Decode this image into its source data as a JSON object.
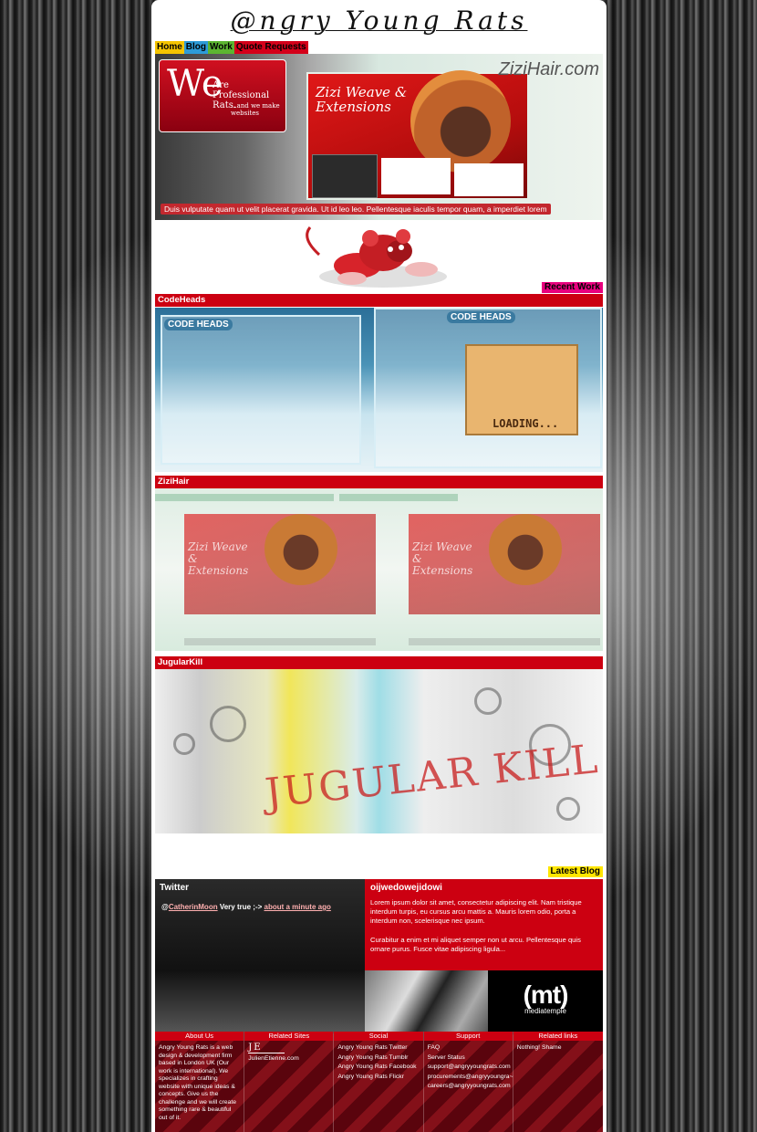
{
  "site_title": "@ngry Young Rats",
  "nav": [
    "Home",
    "Blog",
    "Work",
    "Quote Requests"
  ],
  "hero": {
    "we": "We",
    "line1": "Are Professional Rats.",
    "line2": "...and we make websites",
    "shot_title": "Zizi Weave & Extensions",
    "logo": "ZiziHair.com",
    "caption": "Duis vulputate quam ut velit placerat gravida. Ut id leo leo. Pellentesque iaculis tempor quam, a imperdiet lorem"
  },
  "recent_work_tag": "Recent Work",
  "works": [
    {
      "title": "CodeHeads"
    },
    {
      "title": "ZiziHair"
    },
    {
      "title": "JugularKill"
    }
  ],
  "codeheads": {
    "logo": "CODE HEADS",
    "loading": "LOADING..."
  },
  "zizihair": {
    "shot_title": "Zizi Weave & Extensions"
  },
  "jugularkill": {
    "art_text": "JUGULAR KILL"
  },
  "latest_blog_tag": "Latest Blog",
  "twitter": {
    "heading": "Twitter",
    "prefix": "@",
    "user": "CatherinMoon",
    "text": " Very true ;-> ",
    "time": "about a minute ago"
  },
  "blog": {
    "title": "oijwedowejidowi",
    "p1": "Lorem ipsum dolor sit amet, consectetur adipiscing elit. Nam tristique interdum turpis, eu cursus arcu mattis a. Mauris lorem odio, porta a interdum non, scelerisque nec ipsum.",
    "p2": "Curabitur a enim et mi aliquet semper non ut arcu. Pellentesque quis ornare purus. Fusce vitae adipiscing ligula..."
  },
  "ad": {
    "mt_logo": "(mt)",
    "mt_sub": "mediatemple"
  },
  "footer": {
    "about": {
      "heading": "About Us",
      "text": "Angry Young Rats is a web design & development firm based in London UK (Our work is international). We specializes in crafting website with unique ideas & concepts. Give us the challenge and we will create something rare & beautiful out of it."
    },
    "related_sites": {
      "heading": "Related Sites",
      "items": [
        "JulienEtienne.com"
      ]
    },
    "social": {
      "heading": "Social",
      "items": [
        "Angry Young Rats Twitter",
        "Angry Young Rats Tumblr",
        "Angry Young Rats Facebook",
        "Angry Young Rats Flickr"
      ]
    },
    "support": {
      "heading": "Support",
      "items": [
        "FAQ",
        "Server Status",
        "support@angryyoungrats.com",
        "procurements@angryyoungra~",
        "careers@angryyoungrats.com"
      ]
    },
    "related_links": {
      "heading": "Related links",
      "items": [
        "Nothing! Shame"
      ]
    }
  }
}
